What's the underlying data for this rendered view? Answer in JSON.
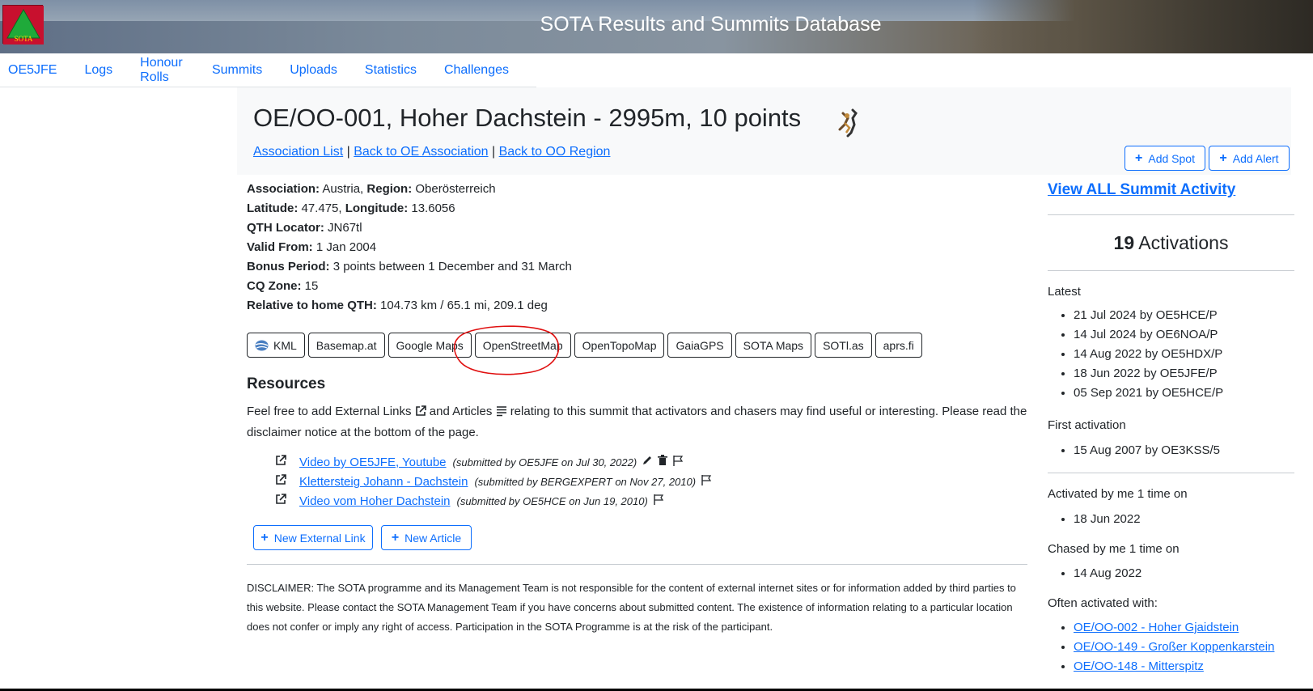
{
  "banner": {
    "title": "SOTA Results and Summits Database",
    "logo_text": "SOTA"
  },
  "nav": [
    "OE5JFE",
    "Logs",
    "Honour Rolls",
    "Summits",
    "Uploads",
    "Statistics",
    "Challenges"
  ],
  "summit": {
    "title": "OE/OO-001, Hoher Dachstein - 2995m, 10 points",
    "breadcrumbs": [
      "Association List",
      "Back to OE Association",
      "Back to OO Region"
    ],
    "separator": "|"
  },
  "actions": {
    "add_spot": "Add Spot",
    "add_alert": "Add Alert"
  },
  "info": {
    "association_label": "Association:",
    "association": "Austria,",
    "region_label": "Region:",
    "region": "Oberösterreich",
    "latitude_label": "Latitude:",
    "latitude": "47.475,",
    "longitude_label": "Longitude:",
    "longitude": "13.6056",
    "qth_label": "QTH Locator:",
    "qth": "JN67tl",
    "valid_label": "Valid From:",
    "valid": "1 Jan 2004",
    "bonus_label": "Bonus Period:",
    "bonus": "3 points between 1 December and 31 March",
    "cq_label": "CQ Zone:",
    "cq": "15",
    "home_label": "Relative to home QTH:",
    "home": "104.73 km / 65.1 mi, 209.1 deg"
  },
  "map_buttons": [
    "KML",
    "Basemap.at",
    "Google Maps",
    "OpenStreetMap",
    "OpenTopoMap",
    "GaiaGPS",
    "SOTA Maps",
    "SOTl.as",
    "aprs.fi"
  ],
  "resources": {
    "title": "Resources",
    "desc_1": "Feel free to add External Links",
    "desc_2": "and Articles",
    "desc_3": "relating to this summit that activators and chasers may find useful or interesting. Please read the disclaimer notice at the bottom of the page.",
    "items": [
      {
        "title": "Video by OE5JFE, Youtube",
        "sub": "(submitted by OE5JFE on Jul 30, 2022)"
      },
      {
        "title": "Klettersteig Johann - Dachstein",
        "sub": "(submitted by BERGEXPERT on Nov 27, 2010)"
      },
      {
        "title": "Video vom Hoher Dachstein",
        "sub": "(submitted by OE5HCE on Jun 19, 2010)"
      }
    ],
    "new_external": "New External Link",
    "new_article": "New Article"
  },
  "disclaimer": "DISCLAIMER: The SOTA programme and its Management Team is not responsible for the content of external internet sites or for information added by third parties to this website. Please contact the SOTA Management Team if you have concerns about submitted content. The existence of information relating to a particular location does not confer or imply any right of access. Participation in the SOTA Programme is at the risk of the participant.",
  "sidebar": {
    "view_all": "View ALL Summit Activity",
    "activation_count": "19",
    "activation_word": "Activations",
    "latest_label": "Latest",
    "latest": [
      "21 Jul 2024 by OE5HCE/P",
      "14 Jul 2024 by OE6NOA/P",
      "14 Aug 2022 by OE5HDX/P",
      "18 Jun 2022 by OE5JFE/P",
      "05 Sep 2021 by OE5HCE/P"
    ],
    "first_label": "First activation",
    "first": [
      "15 Aug 2007 by OE3KSS/5"
    ],
    "activated_label": "Activated by me 1 time on",
    "activated": [
      "18 Jun 2022"
    ],
    "chased_label": "Chased by me 1 time on",
    "chased": [
      "14 Aug 2022"
    ],
    "often_label": "Often activated with:",
    "often": [
      "OE/OO-002 - Hoher Gjaidstein",
      "OE/OO-149 - Großer Koppenkarstein",
      "OE/OO-148 - Mitterspitz"
    ]
  },
  "colors": {
    "link": "#0d6efd",
    "annotation": "#e01010"
  }
}
